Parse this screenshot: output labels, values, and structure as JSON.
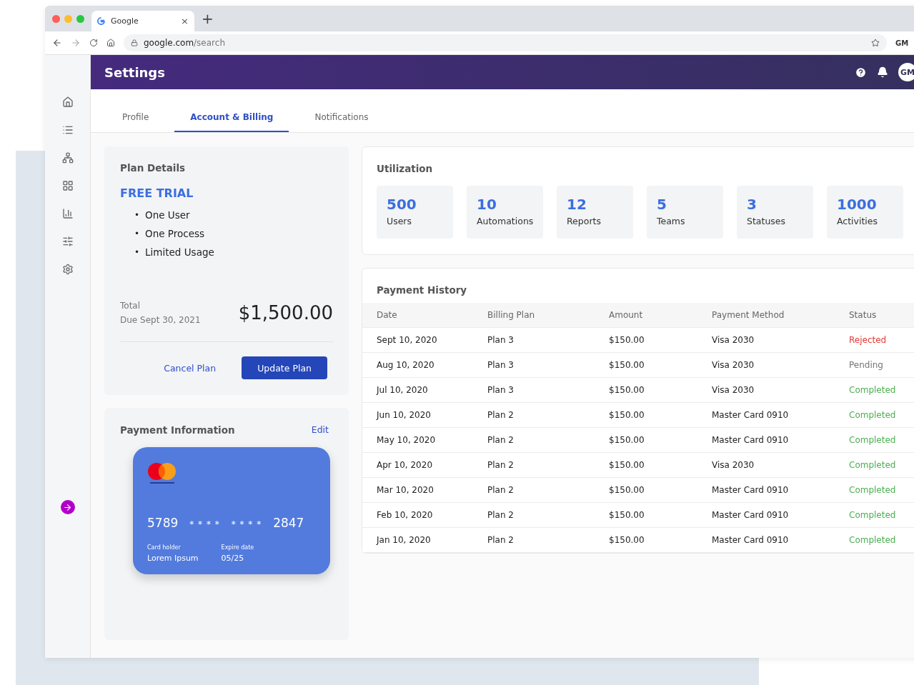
{
  "browser": {
    "tab_title": "Google",
    "tab_close": "×",
    "new_tab": "+",
    "url_host": "google.com",
    "url_path": "/search",
    "profile": "GM"
  },
  "header": {
    "title": "Settings",
    "avatar": "GM"
  },
  "tabs": [
    {
      "label": "Profile",
      "selected": false
    },
    {
      "label": "Account & Billing",
      "selected": true
    },
    {
      "label": "Notifications",
      "selected": false
    }
  ],
  "plan": {
    "title": "Plan Details",
    "name": "FREE TRIAL",
    "features": [
      {
        "bullet": "•",
        "text": "One User"
      },
      {
        "bullet": "•",
        "text": "One Process"
      },
      {
        "bullet": "•",
        "text": "Limited Usage"
      }
    ],
    "total_label": "Total",
    "due": "Due Sept 30, 2021",
    "amount": "$1,500.00",
    "cancel": "Cancel Plan",
    "update": "Update Plan"
  },
  "payment_info": {
    "title": "Payment Information",
    "edit": "Edit",
    "card": {
      "groups": [
        "5789",
        "* * * *",
        "* * * *",
        "2847"
      ],
      "holder_label": "Card holder",
      "holder": "Lorem Ipsum",
      "expiry_label": "Expire date",
      "expiry": "05/25"
    }
  },
  "utilization": {
    "title": "Utilization",
    "stats": [
      {
        "value": "500",
        "label": "Users"
      },
      {
        "value": "10",
        "label": "Automations"
      },
      {
        "value": "12",
        "label": "Reports"
      },
      {
        "value": "5",
        "label": "Teams"
      },
      {
        "value": "3",
        "label": "Statuses"
      },
      {
        "value": "1000",
        "label": "Activities"
      }
    ]
  },
  "payment_history": {
    "title": "Payment History",
    "columns": [
      "Date",
      "Billing Plan",
      "Amount",
      "Payment Method",
      "Status"
    ],
    "rows": [
      {
        "date": "Sept 10, 2020",
        "plan": "Plan 3",
        "amount": "$150.00",
        "method": "Visa 2030",
        "status": "Rejected",
        "color": "#e53935"
      },
      {
        "date": "Aug 10, 2020",
        "plan": "Plan 3",
        "amount": "$150.00",
        "method": "Visa 2030",
        "status": "Pending",
        "color": "#757575"
      },
      {
        "date": "Jul 10, 2020",
        "plan": "Plan 3",
        "amount": "$150.00",
        "method": "Visa 2030",
        "status": "Completed",
        "color": "#4caf50"
      },
      {
        "date": "Jun 10, 2020",
        "plan": "Plan 2",
        "amount": "$150.00",
        "method": "Master Card 0910",
        "status": "Completed",
        "color": "#4caf50"
      },
      {
        "date": "May 10, 2020",
        "plan": "Plan 2",
        "amount": "$150.00",
        "method": "Master Card 0910",
        "status": "Completed",
        "color": "#4caf50"
      },
      {
        "date": "Apr 10, 2020",
        "plan": "Plan 2",
        "amount": "$150.00",
        "method": "Visa 2030",
        "status": "Completed",
        "color": "#4caf50"
      },
      {
        "date": "Mar 10, 2020",
        "plan": "Plan 2",
        "amount": "$150.00",
        "method": "Master Card 0910",
        "status": "Completed",
        "color": "#4caf50"
      },
      {
        "date": "Feb 10, 2020",
        "plan": "Plan 2",
        "amount": "$150.00",
        "method": "Master Card 0910",
        "status": "Completed",
        "color": "#4caf50"
      },
      {
        "date": "Jan 10, 2020",
        "plan": "Plan 2",
        "amount": "$150.00",
        "method": "Master Card 0910",
        "status": "Completed",
        "color": "#4caf50"
      }
    ]
  }
}
